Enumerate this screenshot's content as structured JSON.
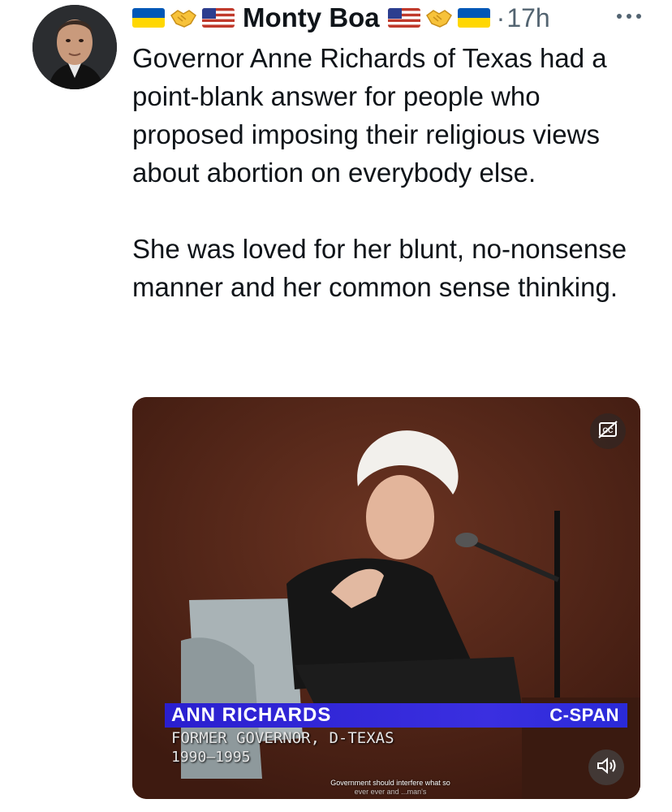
{
  "author": {
    "display_name": "Monty Boa",
    "emoji_left": [
      "ukraine-flag",
      "handshake",
      "us-flag"
    ],
    "emoji_right": [
      "us-flag",
      "handshake",
      "ukraine-flag"
    ]
  },
  "tweet": {
    "separator": "·",
    "time": "17h",
    "paragraphs": [
      "Governor Anne Richards of Texas had a point-blank answer for people who proposed imposing their religious views about abortion on everybody else.",
      "She was loved for her blunt, no-nonsense manner and her common sense thinking."
    ]
  },
  "media": {
    "lower_third_name": "ANN RICHARDS",
    "lower_third_title": "FORMER GOVERNOR, D-TEXAS",
    "lower_third_years": "1990–1995",
    "network": "C-SPAN",
    "subtitle_line1": "Government should interfere what so",
    "subtitle_line2": "ever ever and ...man's",
    "icons": [
      "captions-off-icon",
      "volume-icon"
    ]
  },
  "colors": {
    "lower_third_blue": "#2a1fcf",
    "meta_gray": "#536471",
    "ukraine_blue": "#0057b7",
    "ukraine_yellow": "#ffd700"
  }
}
